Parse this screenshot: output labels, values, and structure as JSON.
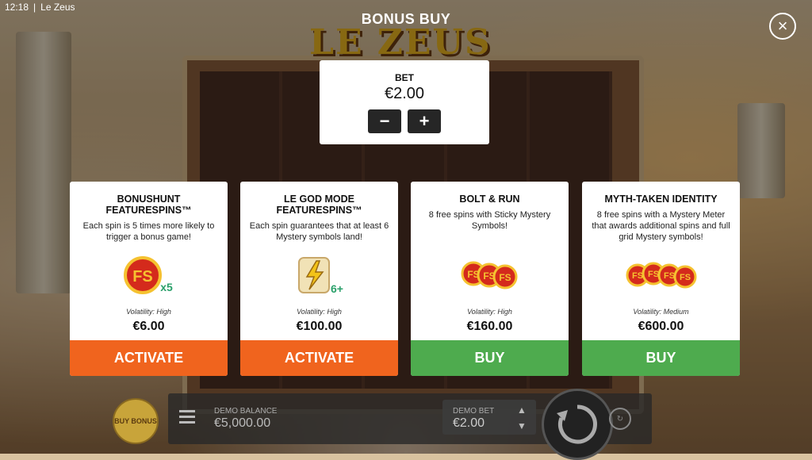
{
  "status": {
    "time": "12:18",
    "app": "Le Zeus"
  },
  "logo": "LE ZEUS",
  "title": "BONUS BUY",
  "close_icon": "×",
  "bet": {
    "label": "BET",
    "value": "€2.00",
    "minus": "−",
    "plus": "+"
  },
  "cards": [
    {
      "title": "BONUSHUNT FEATURESPINS™",
      "desc": "Each spin is 5 times more likely to trigger a bonus game!",
      "icon": "fs-coin-x5-icon",
      "multiplier": "x5",
      "volatility": "Volatility: High",
      "price": "€6.00",
      "button": "ACTIVATE",
      "button_color": "#f0641e"
    },
    {
      "title": "LE GOD MODE FEATURESPINS™",
      "desc": "Each spin guarantees that at least 6 Mystery symbols land!",
      "icon": "mystery-scroll-6plus-icon",
      "multiplier": "6+",
      "volatility": "Volatility: High",
      "price": "€100.00",
      "button": "ACTIVATE",
      "button_color": "#f0641e"
    },
    {
      "title": "BOLT & RUN",
      "desc": "8 free spins with Sticky Mystery Symbols!",
      "icon": "fs-coins-3-icon",
      "volatility": "Volatility: High",
      "price": "€160.00",
      "button": "BUY",
      "button_color": "#4eab4e"
    },
    {
      "title": "MYTH-TAKEN IDENTITY",
      "desc": "8 free spins with a Mystery Meter that awards additional spins and full grid Mystery symbols!",
      "icon": "fs-coins-4-icon",
      "volatility": "Volatility: Medium",
      "price": "€600.00",
      "button": "BUY",
      "button_color": "#4eab4e"
    }
  ],
  "bottom": {
    "buy_bonus": "BUY BONUS",
    "balance_label": "DEMO BALANCE",
    "balance_value": "€5,000.00",
    "bet_label": "DEMO BET",
    "bet_value": "€2.00"
  }
}
